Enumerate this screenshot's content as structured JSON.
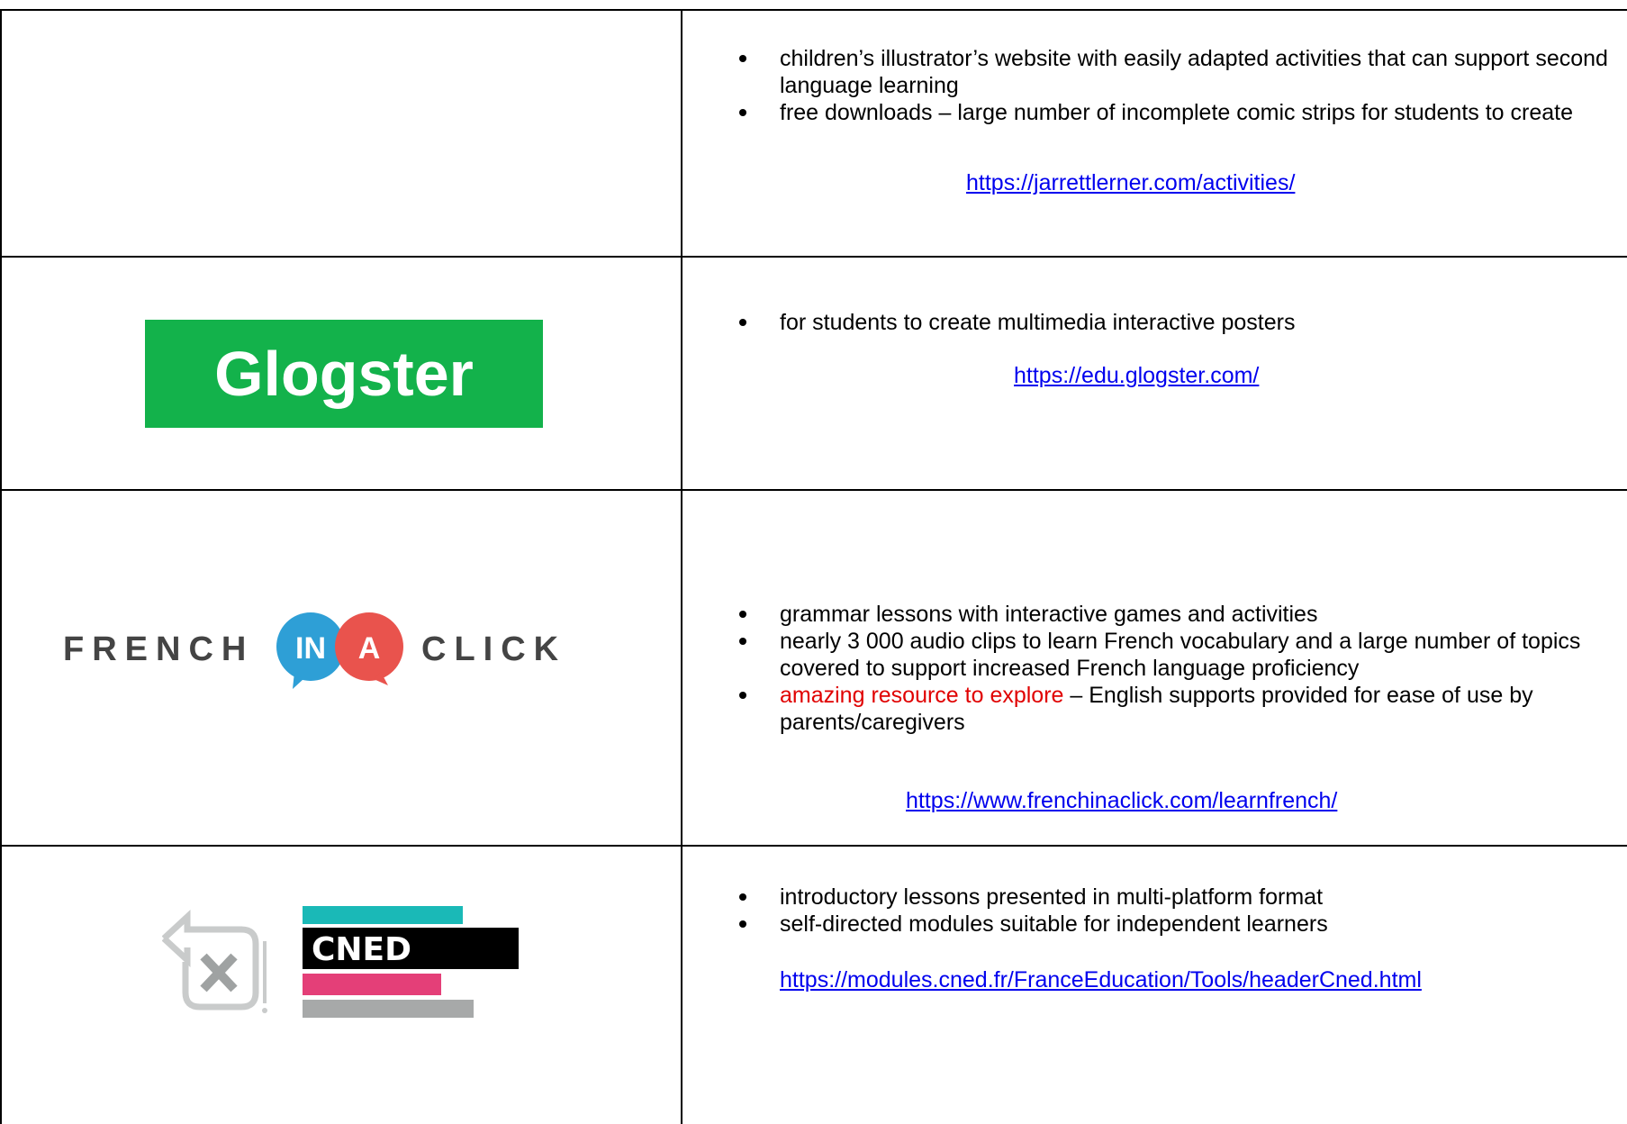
{
  "rows": [
    {
      "bullets": [
        "children’s illustrator’s website with easily adapted activities that can support second language learning",
        "free downloads – large number of incomplete comic strips for students to create"
      ],
      "link": "https://jarrettlerner.com/activities/"
    },
    {
      "logo_text": "Glogster",
      "bullets": [
        "for students to create multimedia interactive posters"
      ],
      "link": "https://edu.glogster.com/"
    },
    {
      "logo_text_left": "FRENCH",
      "logo_bubble_1": "IN",
      "logo_bubble_2": "A",
      "logo_text_right": "CLICK",
      "bullets": [
        "grammar lessons with interactive games and activities",
        "nearly 3 000 audio clips to learn French vocabulary and a large number of topics covered to support increased French language proficiency"
      ],
      "bullet_highlight": "amazing resource to explore",
      "bullet_rest": " – English supports provided for ease of use by parents/caregivers",
      "link": "https://www.frenchinaclick.com/learnfrench/"
    },
    {
      "logo_text": "CNED",
      "bullets": [
        "introductory lessons presented in multi-platform format",
        "self-directed modules suitable for independent learners"
      ],
      "link": "https://modules.cned.fr/FranceEducation/Tools/headerCned.html"
    }
  ],
  "colors": {
    "link": "#0000ee",
    "highlight": "#e00000",
    "glogster_green": "#13b24b",
    "fic_blue": "#2e9fd6",
    "fic_red": "#e9534d",
    "cned_teal": "#1ab9b7",
    "cned_pink": "#e43f78",
    "cned_gray": "#a7a9a9"
  }
}
